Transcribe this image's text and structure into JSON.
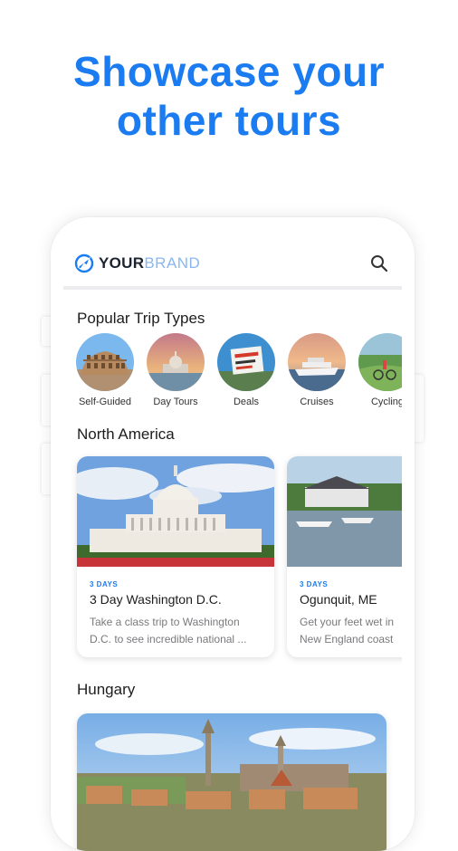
{
  "headline": {
    "line1": "Showcase your",
    "line2": "other tours"
  },
  "colors": {
    "accent": "#1a7cf0",
    "brand_light": "#8ab7ef"
  },
  "app": {
    "brand_prefix": "YOUR",
    "brand_suffix": "BRAND",
    "logo_icon": "globe-plane-icon",
    "search_icon": "search-icon"
  },
  "popular": {
    "title": "Popular Trip Types",
    "items": [
      {
        "label": "Self-Guided",
        "icon": "colosseum-photo"
      },
      {
        "label": "Day Tours",
        "icon": "capitol-sunset-photo"
      },
      {
        "label": "Deals",
        "icon": "deals-sign-photo"
      },
      {
        "label": "Cruises",
        "icon": "cruise-ship-photo"
      },
      {
        "label": "Cycling",
        "icon": "cyclists-photo"
      }
    ]
  },
  "north_america": {
    "title": "North America",
    "cards": [
      {
        "days": "3 DAYS",
        "title": "3 Day Washington D.C.",
        "desc_line1": "Take a class trip to Washington",
        "desc_line2": "D.C. to see incredible national ..."
      },
      {
        "days": "3 DAYS",
        "title": "Ogunquit, ME",
        "desc_line1": "Get your feet wet in",
        "desc_line2": "New England coast"
      }
    ]
  },
  "hungary": {
    "title": "Hungary"
  }
}
